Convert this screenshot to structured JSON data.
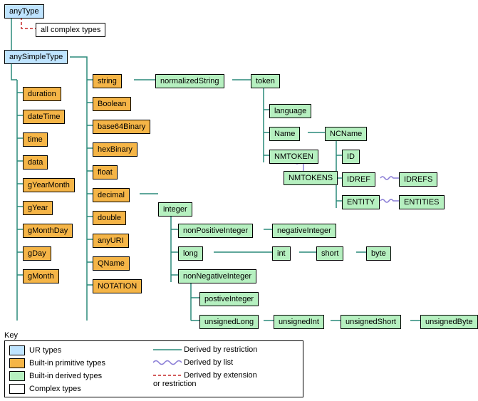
{
  "nodes": {
    "anyType": "anyType",
    "allComplex": "all complex types",
    "anySimpleType": "anySimpleType",
    "string": "string",
    "normalizedString": "normalizedString",
    "token": "token",
    "language": "language",
    "Name": "Name",
    "NCName": "NCName",
    "NMTOKEN": "NMTOKEN",
    "NMTOKENS": "NMTOKENS",
    "ID": "ID",
    "IDREF": "IDREF",
    "IDREFS": "IDREFS",
    "ENTITY": "ENTITY",
    "ENTITIES": "ENTITIES",
    "duration": "duration",
    "dateTime": "dateTime",
    "time": "time",
    "data": "data",
    "gYearMonth": "gYearMonth",
    "gYear": "gYear",
    "gMonthDay": "gMonthDay",
    "gDay": "gDay",
    "gMonth": "gMonth",
    "Boolean": "Boolean",
    "base64Binary": "base64Binary",
    "hexBinary": "hexBinary",
    "float": "float",
    "decimal": "decimal",
    "double": "double",
    "anyURI": "anyURI",
    "QName": "QName",
    "NOTATION": "NOTATION",
    "integer": "integer",
    "nonPositiveInteger": "nonPositiveInteger",
    "negativeInteger": "negativeInteger",
    "long": "long",
    "int": "int",
    "short": "short",
    "byte": "byte",
    "nonNegativeInteger": "nonNegativeInteger",
    "positiveInteger": "postiveInteger",
    "unsignedLong": "unsignedLong",
    "unsignedInt": "unsignedInt",
    "unsignedShort": "unsignedShort",
    "unsignedByte": "unsignedByte"
  },
  "legend": {
    "title": "Key",
    "ur": "UR types",
    "prim": "Built-in primitive types",
    "deriv": "Built-in derived types",
    "cplx": "Complex types",
    "restriction": "Derived by restriction",
    "list": "Derived by list",
    "ext": "Derived by extension\nor restriction"
  },
  "chart_data": {
    "type": "tree",
    "title": "XML Schema built-in datatype hierarchy",
    "node_categories": [
      "UR types",
      "Built-in primitive types",
      "Built-in derived types",
      "Complex types"
    ],
    "edge_categories": [
      "Derived by restriction",
      "Derived by list",
      "Derived by extension or restriction"
    ],
    "nodes": [
      {
        "id": "anyType",
        "category": "UR types"
      },
      {
        "id": "all complex types",
        "category": "Complex types"
      },
      {
        "id": "anySimpleType",
        "category": "UR types"
      },
      {
        "id": "string",
        "category": "Built-in primitive types"
      },
      {
        "id": "duration",
        "category": "Built-in primitive types"
      },
      {
        "id": "dateTime",
        "category": "Built-in primitive types"
      },
      {
        "id": "time",
        "category": "Built-in primitive types"
      },
      {
        "id": "data",
        "category": "Built-in primitive types"
      },
      {
        "id": "gYearMonth",
        "category": "Built-in primitive types"
      },
      {
        "id": "gYear",
        "category": "Built-in primitive types"
      },
      {
        "id": "gMonthDay",
        "category": "Built-in primitive types"
      },
      {
        "id": "gDay",
        "category": "Built-in primitive types"
      },
      {
        "id": "gMonth",
        "category": "Built-in primitive types"
      },
      {
        "id": "Boolean",
        "category": "Built-in primitive types"
      },
      {
        "id": "base64Binary",
        "category": "Built-in primitive types"
      },
      {
        "id": "hexBinary",
        "category": "Built-in primitive types"
      },
      {
        "id": "float",
        "category": "Built-in primitive types"
      },
      {
        "id": "decimal",
        "category": "Built-in primitive types"
      },
      {
        "id": "double",
        "category": "Built-in primitive types"
      },
      {
        "id": "anyURI",
        "category": "Built-in primitive types"
      },
      {
        "id": "QName",
        "category": "Built-in primitive types"
      },
      {
        "id": "NOTATION",
        "category": "Built-in primitive types"
      },
      {
        "id": "normalizedString",
        "category": "Built-in derived types"
      },
      {
        "id": "token",
        "category": "Built-in derived types"
      },
      {
        "id": "language",
        "category": "Built-in derived types"
      },
      {
        "id": "Name",
        "category": "Built-in derived types"
      },
      {
        "id": "NCName",
        "category": "Built-in derived types"
      },
      {
        "id": "NMTOKEN",
        "category": "Built-in derived types"
      },
      {
        "id": "NMTOKENS",
        "category": "Built-in derived types"
      },
      {
        "id": "ID",
        "category": "Built-in derived types"
      },
      {
        "id": "IDREF",
        "category": "Built-in derived types"
      },
      {
        "id": "IDREFS",
        "category": "Built-in derived types"
      },
      {
        "id": "ENTITY",
        "category": "Built-in derived types"
      },
      {
        "id": "ENTITIES",
        "category": "Built-in derived types"
      },
      {
        "id": "integer",
        "category": "Built-in derived types"
      },
      {
        "id": "nonPositiveInteger",
        "category": "Built-in derived types"
      },
      {
        "id": "negativeInteger",
        "category": "Built-in derived types"
      },
      {
        "id": "long",
        "category": "Built-in derived types"
      },
      {
        "id": "int",
        "category": "Built-in derived types"
      },
      {
        "id": "short",
        "category": "Built-in derived types"
      },
      {
        "id": "byte",
        "category": "Built-in derived types"
      },
      {
        "id": "nonNegativeInteger",
        "category": "Built-in derived types"
      },
      {
        "id": "postiveInteger",
        "category": "Built-in derived types"
      },
      {
        "id": "unsignedLong",
        "category": "Built-in derived types"
      },
      {
        "id": "unsignedInt",
        "category": "Built-in derived types"
      },
      {
        "id": "unsignedShort",
        "category": "Built-in derived types"
      },
      {
        "id": "unsignedByte",
        "category": "Built-in derived types"
      }
    ],
    "edges": [
      {
        "from": "anyType",
        "to": "all complex types",
        "kind": "Derived by extension or restriction"
      },
      {
        "from": "anyType",
        "to": "anySimpleType",
        "kind": "Derived by restriction"
      },
      {
        "from": "anySimpleType",
        "to": "string",
        "kind": "Derived by restriction"
      },
      {
        "from": "anySimpleType",
        "to": "duration",
        "kind": "Derived by restriction"
      },
      {
        "from": "anySimpleType",
        "to": "dateTime",
        "kind": "Derived by restriction"
      },
      {
        "from": "anySimpleType",
        "to": "time",
        "kind": "Derived by restriction"
      },
      {
        "from": "anySimpleType",
        "to": "data",
        "kind": "Derived by restriction"
      },
      {
        "from": "anySimpleType",
        "to": "gYearMonth",
        "kind": "Derived by restriction"
      },
      {
        "from": "anySimpleType",
        "to": "gYear",
        "kind": "Derived by restriction"
      },
      {
        "from": "anySimpleType",
        "to": "gMonthDay",
        "kind": "Derived by restriction"
      },
      {
        "from": "anySimpleType",
        "to": "gDay",
        "kind": "Derived by restriction"
      },
      {
        "from": "anySimpleType",
        "to": "gMonth",
        "kind": "Derived by restriction"
      },
      {
        "from": "anySimpleType",
        "to": "Boolean",
        "kind": "Derived by restriction"
      },
      {
        "from": "anySimpleType",
        "to": "base64Binary",
        "kind": "Derived by restriction"
      },
      {
        "from": "anySimpleType",
        "to": "hexBinary",
        "kind": "Derived by restriction"
      },
      {
        "from": "anySimpleType",
        "to": "float",
        "kind": "Derived by restriction"
      },
      {
        "from": "anySimpleType",
        "to": "decimal",
        "kind": "Derived by restriction"
      },
      {
        "from": "anySimpleType",
        "to": "double",
        "kind": "Derived by restriction"
      },
      {
        "from": "anySimpleType",
        "to": "anyURI",
        "kind": "Derived by restriction"
      },
      {
        "from": "anySimpleType",
        "to": "QName",
        "kind": "Derived by restriction"
      },
      {
        "from": "anySimpleType",
        "to": "NOTATION",
        "kind": "Derived by restriction"
      },
      {
        "from": "string",
        "to": "normalizedString",
        "kind": "Derived by restriction"
      },
      {
        "from": "normalizedString",
        "to": "token",
        "kind": "Derived by restriction"
      },
      {
        "from": "token",
        "to": "language",
        "kind": "Derived by restriction"
      },
      {
        "from": "token",
        "to": "Name",
        "kind": "Derived by restriction"
      },
      {
        "from": "token",
        "to": "NMTOKEN",
        "kind": "Derived by restriction"
      },
      {
        "from": "Name",
        "to": "NCName",
        "kind": "Derived by restriction"
      },
      {
        "from": "NMTOKEN",
        "to": "NMTOKENS",
        "kind": "Derived by list"
      },
      {
        "from": "NCName",
        "to": "ID",
        "kind": "Derived by restriction"
      },
      {
        "from": "NCName",
        "to": "IDREF",
        "kind": "Derived by restriction"
      },
      {
        "from": "NCName",
        "to": "ENTITY",
        "kind": "Derived by restriction"
      },
      {
        "from": "IDREF",
        "to": "IDREFS",
        "kind": "Derived by list"
      },
      {
        "from": "ENTITY",
        "to": "ENTITIES",
        "kind": "Derived by list"
      },
      {
        "from": "decimal",
        "to": "integer",
        "kind": "Derived by restriction"
      },
      {
        "from": "integer",
        "to": "nonPositiveInteger",
        "kind": "Derived by restriction"
      },
      {
        "from": "integer",
        "to": "long",
        "kind": "Derived by restriction"
      },
      {
        "from": "integer",
        "to": "nonNegativeInteger",
        "kind": "Derived by restriction"
      },
      {
        "from": "nonPositiveInteger",
        "to": "negativeInteger",
        "kind": "Derived by restriction"
      },
      {
        "from": "long",
        "to": "int",
        "kind": "Derived by restriction"
      },
      {
        "from": "int",
        "to": "short",
        "kind": "Derived by restriction"
      },
      {
        "from": "short",
        "to": "byte",
        "kind": "Derived by restriction"
      },
      {
        "from": "nonNegativeInteger",
        "to": "postiveInteger",
        "kind": "Derived by restriction"
      },
      {
        "from": "nonNegativeInteger",
        "to": "unsignedLong",
        "kind": "Derived by restriction"
      },
      {
        "from": "unsignedLong",
        "to": "unsignedInt",
        "kind": "Derived by restriction"
      },
      {
        "from": "unsignedInt",
        "to": "unsignedShort",
        "kind": "Derived by restriction"
      },
      {
        "from": "unsignedShort",
        "to": "unsignedByte",
        "kind": "Derived by restriction"
      }
    ]
  }
}
